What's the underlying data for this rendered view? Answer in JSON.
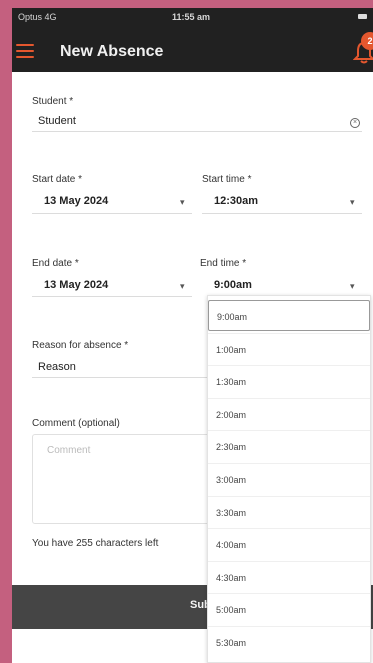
{
  "status_bar": {
    "carrier": "Optus 4G",
    "time": "11:55 am"
  },
  "header": {
    "title": "New Absence",
    "notification_count": "2"
  },
  "form": {
    "student": {
      "label": "Student *",
      "value": "Student"
    },
    "start_date": {
      "label": "Start date *",
      "value": "13 May 2024"
    },
    "start_time": {
      "label": "Start time *",
      "value": "12:30am"
    },
    "end_date": {
      "label": "End date *",
      "value": "13 May 2024"
    },
    "end_time": {
      "label": "End time *",
      "value": "9:00am"
    },
    "reason": {
      "label": "Reason for absence *",
      "value": "Reason"
    },
    "comment": {
      "label": "Comment (optional)",
      "placeholder": "Comment"
    },
    "chars_left": "You have 255 characters left",
    "submit_label": "Sub"
  },
  "time_options": [
    "9:00am",
    "1:00am",
    "1:30am",
    "2:00am",
    "2:30am",
    "3:00am",
    "3:30am",
    "4:00am",
    "4:30am",
    "5:00am",
    "5:30am"
  ],
  "selected_option_index": 0,
  "colors": {
    "accent": "#e4572e",
    "header_bg": "#212121",
    "frame_bg": "#c4607f",
    "submit_bg": "#454545"
  }
}
